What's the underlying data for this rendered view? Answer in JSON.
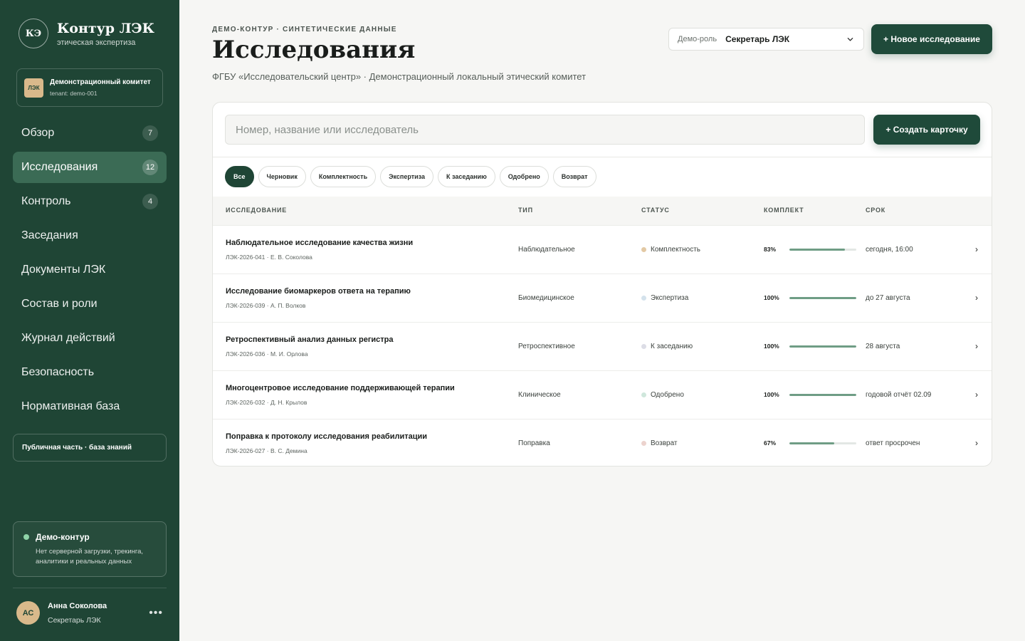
{
  "brand": {
    "logo": "КЭ",
    "title": "Контур ЛЭК",
    "subtitle": "этическая экспертиза"
  },
  "committee": {
    "badge": "ЛЭК",
    "name": "Демонстрационный комитет",
    "tenant": "tenant: demo-001"
  },
  "nav": [
    {
      "label": "Обзор",
      "count": "7",
      "active": false
    },
    {
      "label": "Исследования",
      "count": "12",
      "active": true
    },
    {
      "label": "Контроль",
      "count": "4",
      "active": false
    },
    {
      "label": "Заседания",
      "count": "",
      "active": false
    },
    {
      "label": "Документы ЛЭК",
      "count": "",
      "active": false
    },
    {
      "label": "Состав и роли",
      "count": "",
      "active": false
    },
    {
      "label": "Журнал действий",
      "count": "",
      "active": false
    },
    {
      "label": "Безопасность",
      "count": "",
      "active": false
    },
    {
      "label": "Нормативная база",
      "count": "",
      "active": false
    }
  ],
  "public_link": "Публичная часть · база знаний",
  "demo": {
    "title": "Демо-контур",
    "text": "Нет серверной загрузки, трекинга, аналитики и реальных данных"
  },
  "user": {
    "initials": "АС",
    "name": "Анна Соколова",
    "role": "Секретарь ЛЭК",
    "more": "•••"
  },
  "header": {
    "eyebrow": "ДЕМО-КОНТУР · СИНТЕТИЧЕСКИЕ ДАННЫЕ",
    "title": "Исследования",
    "subtitle": "ФГБУ «Исследовательский центр» · Демонстрационный локальный этический комитет",
    "role_label": "Демо-роль",
    "role_value": "Секретарь ЛЭК",
    "new_button": "+ Новое исследование"
  },
  "search": {
    "placeholder": "Номер, название или исследователь",
    "value": ""
  },
  "create_button": "+ Создать карточку",
  "filters": [
    {
      "label": "Все",
      "active": true
    },
    {
      "label": "Черновик",
      "active": false
    },
    {
      "label": "Комплектность",
      "active": false
    },
    {
      "label": "Экспертиза",
      "active": false
    },
    {
      "label": "К заседанию",
      "active": false
    },
    {
      "label": "Одобрено",
      "active": false
    },
    {
      "label": "Возврат",
      "active": false
    }
  ],
  "table": {
    "columns": [
      "ИССЛЕДОВАНИЕ",
      "ТИП",
      "СТАТУС",
      "КОМПЛЕКТ",
      "СРОК"
    ],
    "rows": [
      {
        "title": "Наблюдательное исследование качества жизни",
        "meta": "ЛЭК-2026-041 · Е. В. Соколова",
        "type": "Наблюдательное",
        "status": "Комплектность",
        "status_color": "#e3c9a4",
        "completeness": "83%",
        "completeness_value": 0.83,
        "due": "сегодня, 16:00",
        "arrow": "›"
      },
      {
        "title": "Исследование биомаркеров ответа на терапию",
        "meta": "ЛЭК-2026-039 · А. П. Волков",
        "type": "Биомедицинское",
        "status": "Экспертиза",
        "status_color": "#d4e2ec",
        "completeness": "100%",
        "completeness_value": 1.0,
        "due": "до 27 августа",
        "arrow": "›"
      },
      {
        "title": "Ретроспективный анализ данных регистра",
        "meta": "ЛЭК-2026-036 · М. И. Орлова",
        "type": "Ретроспективное",
        "status": "К заседанию",
        "status_color": "#dcdde6",
        "completeness": "100%",
        "completeness_value": 1.0,
        "due": "28 августа",
        "arrow": "›"
      },
      {
        "title": "Многоцентровое исследование поддерживающей терапии",
        "meta": "ЛЭК-2026-032 · Д. Н. Крылов",
        "type": "Клиническое",
        "status": "Одобрено",
        "status_color": "#cfe7dc",
        "completeness": "100%",
        "completeness_value": 1.0,
        "due": "годовой отчёт 02.09",
        "arrow": "›"
      },
      {
        "title": "Поправка к протоколу исследования реабилитации",
        "meta": "ЛЭК-2026-027 · В. С. Демина",
        "type": "Поправка",
        "status": "Возврат",
        "status_color": "#ecd3ce",
        "completeness": "67%",
        "completeness_value": 0.67,
        "due": "ответ просрочен",
        "arrow": "›"
      }
    ]
  },
  "colors": {
    "sidebar": "#1f4535",
    "accent": "#1f4a3a",
    "progress": "#6f9d85",
    "active_nav": "#3b6b55"
  }
}
